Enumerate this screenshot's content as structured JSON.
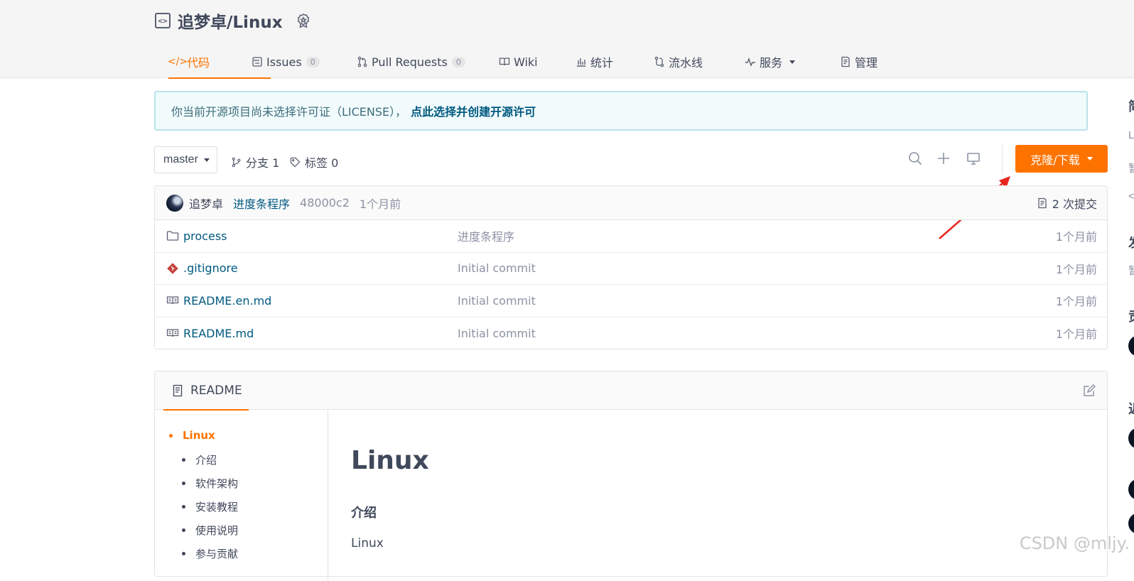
{
  "repo": {
    "title": "追梦卓/Linux"
  },
  "tabs": [
    {
      "label": "代码",
      "icon": "code-icon",
      "active": true
    },
    {
      "label": "Issues",
      "icon": "issues-icon",
      "count": "0"
    },
    {
      "label": "Pull Requests",
      "icon": "pull-request-icon",
      "count": "0"
    },
    {
      "label": "Wiki",
      "icon": "wiki-icon"
    },
    {
      "label": "统计",
      "icon": "stats-icon"
    },
    {
      "label": "流水线",
      "icon": "pipeline-icon"
    },
    {
      "label": "服务",
      "icon": "service-icon"
    },
    {
      "label": "管理",
      "icon": "manage-icon"
    }
  ],
  "notice": {
    "text": "你当前开源项目尚未选择许可证（LICENSE），",
    "link": "点此选择并创建开源许可"
  },
  "toolbar": {
    "branch": "master",
    "branches": "分支 1",
    "tags": "标签 0",
    "clone_label": "克隆/下载"
  },
  "commit": {
    "author": "追梦卓",
    "message": "进度条程序",
    "hash": "48000c2",
    "time": "1个月前",
    "count": "2 次提交"
  },
  "files": [
    {
      "name": "process",
      "type": "folder",
      "commit": "进度条程序",
      "time": "1个月前"
    },
    {
      "name": ".gitignore",
      "type": "git",
      "commit": "Initial commit",
      "time": "1个月前"
    },
    {
      "name": "README.en.md",
      "type": "readme",
      "commit": "Initial commit",
      "time": "1个月前"
    },
    {
      "name": "README.md",
      "type": "readme",
      "commit": "Initial commit",
      "time": "1个月前"
    }
  ],
  "readme": {
    "tab_label": "README",
    "toc": [
      "Linux",
      "介绍",
      "软件架构",
      "安装教程",
      "使用说明",
      "参与贡献"
    ],
    "h1": "Linux",
    "h2": "介绍",
    "p": "Linux"
  },
  "right_panel": {
    "letters": [
      "简",
      "L",
      "暂",
      "<",
      "发",
      "暂",
      "贡",
      "近"
    ]
  },
  "watermark": "CSDN @mljy."
}
